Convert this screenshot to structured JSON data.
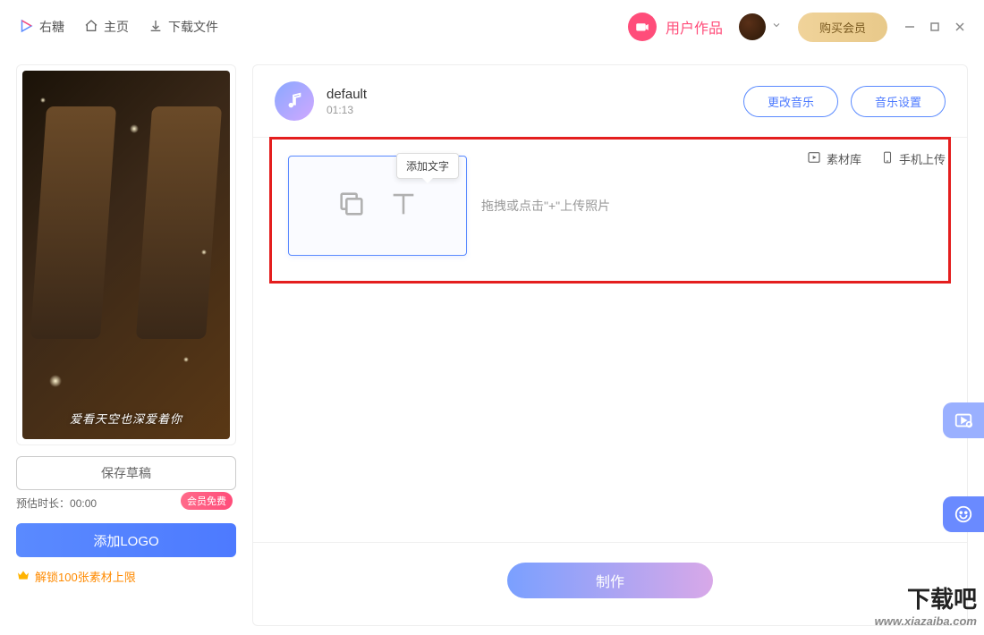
{
  "header": {
    "brand": "右糖",
    "home": "主页",
    "download": "下载文件",
    "user_works": "用户作品",
    "buy_member": "购买会员"
  },
  "left": {
    "preview_caption": "爱看天空也深爱着你",
    "save_draft": "保存草稿",
    "est_label": "预估时长：",
    "est_time": "00:00",
    "member_badge": "会员免费",
    "add_logo": "添加LOGO",
    "unlock_text": "解锁100张素材上限"
  },
  "music": {
    "title": "default",
    "duration": "01:13",
    "change": "更改音乐",
    "settings": "音乐设置"
  },
  "tools": {
    "library": "素材库",
    "phone_upload": "手机上传"
  },
  "upload": {
    "tooltip": "添加文字",
    "hint": "拖拽或点击\"+\"上传照片"
  },
  "bottom": {
    "make": "制作"
  },
  "watermark": {
    "line1": "下载吧",
    "line2": "www.xiazaiba.com"
  }
}
